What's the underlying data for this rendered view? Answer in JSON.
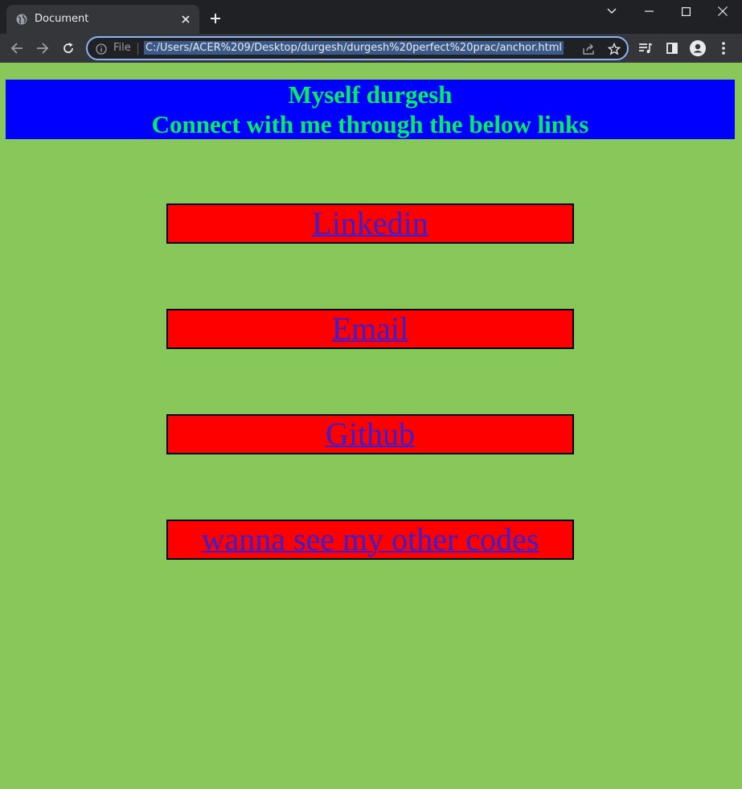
{
  "browser": {
    "tab_title": "Document",
    "chip_label": "File",
    "url": "C:/Users/ACER%209/Desktop/durgesh/durgesh%20perfect%20prac/anchor.html"
  },
  "page": {
    "heading_line1": "Myself durgesh",
    "heading_line2": "Connect with me through the below links",
    "links": [
      {
        "label": "Linkedin"
      },
      {
        "label": "Email"
      },
      {
        "label": "Github"
      },
      {
        "label": "wanna see my other codes"
      }
    ],
    "colors": {
      "background": "#88c85a",
      "header_bg": "#0000ff",
      "header_text": "#00ee66",
      "link_box_bg": "#ff0000",
      "link_text": "#3a1ecf"
    }
  }
}
